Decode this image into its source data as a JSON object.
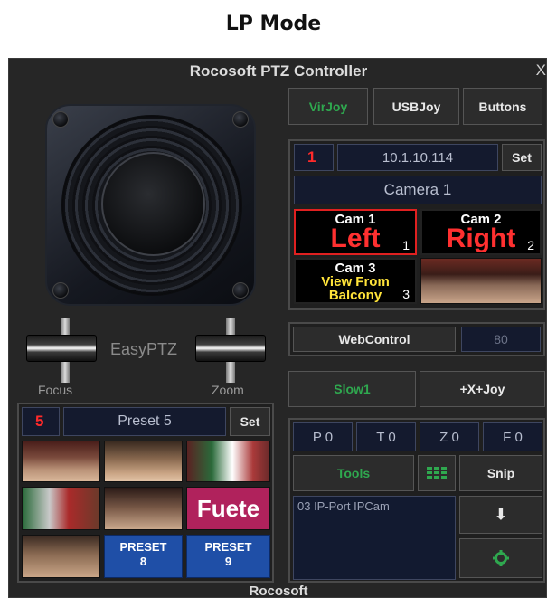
{
  "heading": "LP Mode",
  "window": {
    "title": "Rocosoft PTZ Controller",
    "close": "X",
    "footer": "Rocosoft"
  },
  "colors": {
    "green_text": "#2fa84f",
    "red_text": "#ff2a2a",
    "preset_blue": "#1f4fa7",
    "fuete_magenta": "#b0225c"
  },
  "tabs": {
    "virjoy": "VirJoy",
    "usbjoy": "USBJoy",
    "buttons": "Buttons"
  },
  "camera": {
    "number": "1",
    "ip": "10.1.10.114",
    "set": "Set",
    "name": "Camera 1"
  },
  "cams": [
    {
      "top": "Cam 1",
      "big": "Left",
      "num": "1"
    },
    {
      "top": "Cam 2",
      "big": "Right",
      "num": "2"
    },
    {
      "top": "Cam 3",
      "line1": "View From",
      "line2": "Balcony",
      "num": "3"
    }
  ],
  "webcontrol": {
    "label": "WebControl",
    "value": "80"
  },
  "speed": {
    "slow": "Slow1",
    "mode": "+X+Joy"
  },
  "ptzf": {
    "p": "P 0",
    "t": "T 0",
    "z": "Z 0",
    "f": "F 0"
  },
  "tools": {
    "tools": "Tools",
    "snip": "Snip",
    "grid_icon": "grid-icon",
    "down": "⬇",
    "gear_icon": "gear-icon"
  },
  "log": {
    "text": "03 IP-Port IPCam"
  },
  "left": {
    "easyptz": "EasyPTZ",
    "focus": "Focus",
    "zoom": "Zoom"
  },
  "preset": {
    "number": "5",
    "name": "Preset 5",
    "set": "Set"
  },
  "presets": {
    "fuete": "Fuete",
    "p8_line1": "PRESET",
    "p8_line2": "8",
    "p9_line1": "PRESET",
    "p9_line2": "9"
  }
}
